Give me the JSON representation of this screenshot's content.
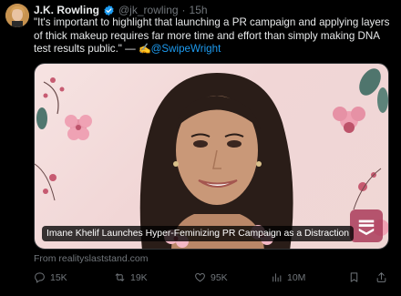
{
  "tweet": {
    "author_name": "J.K. Rowling",
    "handle": "@jk_rowling",
    "separator": "·",
    "time": "15h",
    "text_main": "\"It's important to highlight that launching a PR campaign and applying layers of thick makeup requires far more time and effort than simply making DNA test results public.\" — ",
    "emoji": "✍️",
    "mention": "@SwipeWright",
    "verified_color": "#1d9bf0"
  },
  "media": {
    "caption": "Imane Khelif Launches Hyper-Feminizing PR Campaign as a Distraction",
    "source": "From realityslaststand.com"
  },
  "actions": {
    "replies": "15K",
    "reposts": "19K",
    "likes": "95K",
    "views": "10M"
  }
}
